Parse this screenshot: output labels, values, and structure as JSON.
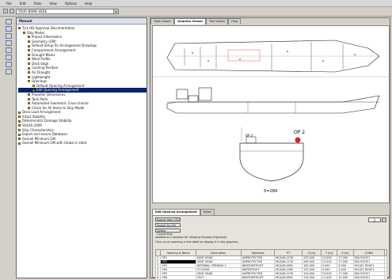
{
  "menu": [
    "File",
    "Edit",
    "Tools",
    "View",
    "Options",
    "Help"
  ],
  "toolbar": {
    "combo_value": "YOUR NAME HERE"
  },
  "tree": {
    "header": "Manual",
    "items": [
      {
        "label": "Tick HD Approval Documentation",
        "indent": 0
      },
      {
        "label": "Ship Model",
        "indent": 1
      },
      {
        "label": "Project Information",
        "indent": 2
      },
      {
        "label": "Geometry (GM)",
        "indent": 2
      },
      {
        "label": "Default Setup for Arrangement Drawings",
        "indent": 2
      },
      {
        "label": "Compartment Arrangement",
        "indent": 2
      },
      {
        "label": "Draught Marks",
        "indent": 2
      },
      {
        "label": "Wind Profile",
        "indent": 2
      },
      {
        "label": "Deck Edge",
        "indent": 2
      },
      {
        "label": "Conning Position",
        "indent": 2
      },
      {
        "label": "Air Draught",
        "indent": 2
      },
      {
        "label": "Lightweight",
        "indent": 2
      },
      {
        "label": "Openings",
        "indent": 2
      },
      {
        "label": "Default Opening Arrangement",
        "indent": 3
      },
      {
        "label": "Edit Opening Arrangement",
        "indent": 3,
        "selected": true
      },
      {
        "label": "Propeller Dimensions",
        "indent": 2
      },
      {
        "label": "Tank Parts",
        "indent": 2
      },
      {
        "label": "Automated Geometric Cross-checks",
        "indent": 2
      },
      {
        "label": "Check for All Items to Ship Model",
        "indent": 2
      },
      {
        "label": "Deck Load Arrangement",
        "indent": 0
      },
      {
        "label": "Intact Stability",
        "indent": 0
      },
      {
        "label": "Deterministic Damage Stability",
        "indent": 0
      },
      {
        "label": "SOLAS 2009",
        "indent": 0
      },
      {
        "label": "Ship Characteristics",
        "indent": 0
      },
      {
        "label": "Export and secure Database",
        "indent": 0
      },
      {
        "label": "Overall Minimum GM",
        "indent": 0
      },
      {
        "label": "Overall Minimum GM with Global in Hold",
        "indent": 0
      }
    ]
  },
  "main": {
    "tabs": [
      "Table Viewer",
      "Graphics Viewer",
      "Text Viewer",
      "Help"
    ],
    "active_tab": 1,
    "drawing": {
      "point_label": "OP 2",
      "section_label": "OP 2",
      "frame_label": "X=289"
    },
    "lower_tabs": [
      "Edit Opening Arrangement",
      "Notes"
    ],
    "buttons": [
      "Export from CSV",
      "Import to CSV",
      "Define Connection"
    ],
    "note1": "Additional 2 location for Viewing Purpose (Optional)",
    "note2": "Click on an opening in the table to display it in the graphics",
    "filter_value": "2",
    "columns": [
      "",
      "Opening # Name",
      "Description",
      "Tightness",
      "PT",
      "X [m]",
      "Y [m]",
      "Z [m]",
      "CONN",
      ""
    ],
    "rows": [
      [
        "1",
        "OP1",
        "VENT HEAD",
        "UNPROTECTED",
        "MCA/HL1278",
        "200.000",
        "13.000",
        "17.000",
        "SEA ROOF1",
        ""
      ],
      [
        "2",
        "OP2",
        "VENT HEAD",
        "UNPROTECTED",
        "MCA/HL1278",
        "289.000",
        "13.000",
        "17.000",
        "SEA ROOF1",
        ""
      ],
      [
        "3",
        "OP3",
        "INTERNAL OPENING 1",
        "WEATHERTIGHT",
        "MCA/HL3892",
        "180.000",
        "9.000",
        "5.000",
        "HOLD1 ROOF1",
        ""
      ],
      [
        "4",
        "OP4",
        "VT DOOR",
        "WATERTIGHT",
        "MCA/HL1265",
        "120.000",
        "0.000",
        "1.000",
        "HOLD1 ROOF1",
        ""
      ],
      [
        "5",
        "OP5",
        "VENT HEAD",
        "UNPROTECTED",
        "MCA/HL1278",
        "100.000",
        "13.000",
        "17.000",
        "SEA ROOF1",
        ""
      ],
      [
        "6",
        "OP6",
        "TEST",
        "WEATHERTIGHT",
        "MCA/HL3892",
        "150.000",
        "11.000",
        "15.000",
        "SEA ROOF1",
        ""
      ]
    ]
  }
}
